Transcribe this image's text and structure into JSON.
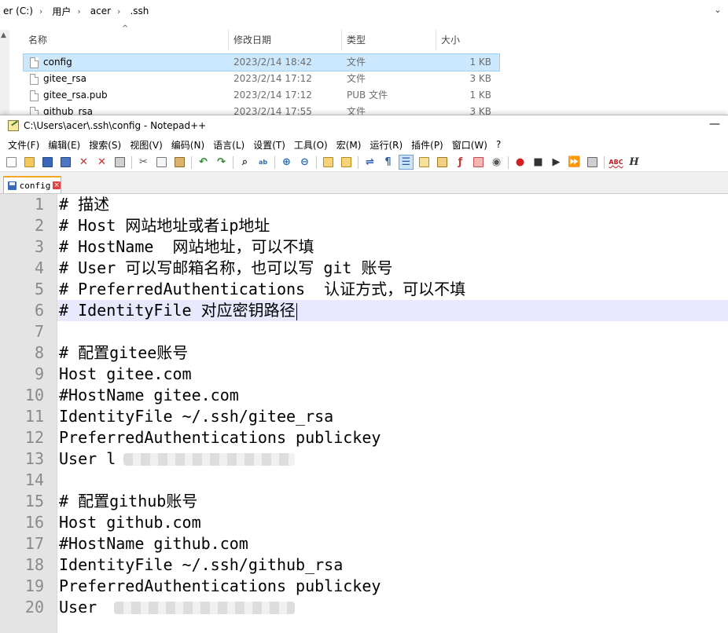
{
  "explorer": {
    "breadcrumb": [
      "er (C:)",
      "用户",
      "acer",
      ".ssh"
    ],
    "columns": {
      "name": "名称",
      "date": "修改日期",
      "type": "类型",
      "size": "大小"
    },
    "files": [
      {
        "name": "config",
        "date": "2023/2/14 18:42",
        "type": "文件",
        "size": "1 KB",
        "selected": true
      },
      {
        "name": "gitee_rsa",
        "date": "2023/2/14 17:12",
        "type": "文件",
        "size": "3 KB"
      },
      {
        "name": "gitee_rsa.pub",
        "date": "2023/2/14 17:12",
        "type": "PUB 文件",
        "size": "1 KB"
      },
      {
        "name": "github_rsa",
        "date": "2023/2/14 17:55",
        "type": "文件",
        "size": "3 KB"
      }
    ]
  },
  "notepad": {
    "title": "C:\\Users\\acer\\.ssh\\config - Notepad++",
    "minimize_symbol": "—",
    "menu": [
      "文件(F)",
      "编辑(E)",
      "搜索(S)",
      "视图(V)",
      "编码(N)",
      "语言(L)",
      "设置(T)",
      "工具(O)",
      "宏(M)",
      "运行(R)",
      "插件(P)",
      "窗口(W)",
      "?"
    ],
    "toolbar": [
      "new-file-icon",
      "open-file-icon",
      "save-icon",
      "save-all-icon",
      "close-icon",
      "close-all-icon",
      "print-icon",
      "sep",
      "cut-icon",
      "copy-icon",
      "paste-icon",
      "sep",
      "undo-icon",
      "redo-icon",
      "sep",
      "find-icon",
      "replace-icon",
      "sep",
      "zoom-in-icon",
      "zoom-out-icon",
      "sep",
      "sync-vertical-icon",
      "sync-horizontal-icon",
      "sep",
      "word-wrap-icon",
      "show-all-chars-icon",
      "indent-guide-icon",
      "user-define-lang-icon",
      "doc-map-icon",
      "function-list-icon",
      "folder-as-workspace-icon",
      "monitor-icon",
      "sep",
      "record-macro-icon",
      "stop-record-icon",
      "play-macro-icon",
      "play-multiple-icon",
      "save-macro-icon",
      "sep",
      "spell-check-icon",
      "html-tag-icon"
    ],
    "tab": {
      "label": "config",
      "close": "×"
    },
    "current_line": 6,
    "lines": [
      "# 描述",
      "# Host 网站地址或者ip地址",
      "# HostName  网站地址，可以不填",
      "# User 可以写邮箱名称，也可以写 git 账号",
      "# PreferredAuthentications  认证方式，可以不填",
      "# IdentityFile 对应密钥路径",
      "",
      "# 配置gitee账号",
      "Host gitee.com",
      "#HostName gitee.com",
      "IdentityFile ~/.ssh/gitee_rsa",
      "PreferredAuthentications publickey",
      "User l",
      "",
      "# 配置github账号",
      "Host github.com",
      "#HostName github.com",
      "IdentityFile ~/.ssh/github_rsa",
      "PreferredAuthentications publickey",
      "User "
    ],
    "line_numbers": [
      "1",
      "2",
      "3",
      "4",
      "5",
      "6",
      "7",
      "8",
      "9",
      "10",
      "11",
      "12",
      "13",
      "14",
      "15",
      "16",
      "17",
      "18",
      "19",
      "20"
    ]
  }
}
